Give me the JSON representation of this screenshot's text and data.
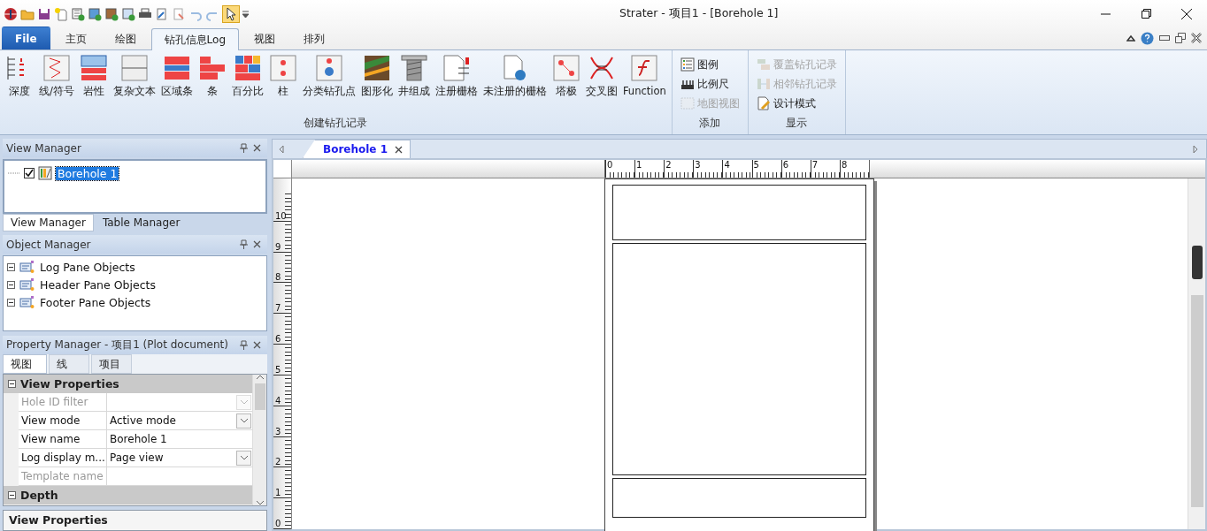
{
  "window": {
    "title": "Strater - 项目1 - [Borehole 1]"
  },
  "ribbon_tabs": [
    {
      "label": "File",
      "kind": "file",
      "selected": false
    },
    {
      "label": "主页",
      "kind": "tab",
      "selected": false
    },
    {
      "label": "绘图",
      "kind": "tab",
      "selected": false
    },
    {
      "label": "钻孔信息Log",
      "kind": "tab",
      "selected": true
    },
    {
      "label": "视图",
      "kind": "tab",
      "selected": false
    },
    {
      "label": "排列",
      "kind": "tab",
      "selected": false
    }
  ],
  "ribbon_groups": [
    {
      "title": "创建钻孔记录",
      "kind": "large",
      "items": [
        {
          "label": "深度",
          "disabled": false
        },
        {
          "label": "线/符号",
          "disabled": false
        },
        {
          "label": "岩性",
          "disabled": false
        },
        {
          "label": "复杂文本",
          "disabled": false
        },
        {
          "label": "区域条",
          "disabled": false
        },
        {
          "label": "条",
          "disabled": false
        },
        {
          "label": "百分比",
          "disabled": false
        },
        {
          "label": "柱",
          "disabled": false
        },
        {
          "label": "分类钻孔点",
          "disabled": false
        },
        {
          "label": "图形化",
          "disabled": false
        },
        {
          "label": "井组成",
          "disabled": false
        },
        {
          "label": "注册栅格",
          "disabled": false
        },
        {
          "label": "未注册的栅格",
          "disabled": false
        },
        {
          "label": "塔极",
          "disabled": false
        },
        {
          "label": "交叉图",
          "disabled": false
        },
        {
          "label": "Function",
          "disabled": false
        }
      ]
    },
    {
      "title": "添加",
      "kind": "small",
      "items": [
        {
          "label": "图例",
          "disabled": false
        },
        {
          "label": "比例尺",
          "disabled": false
        },
        {
          "label": "地图视图",
          "disabled": true
        }
      ]
    },
    {
      "title": "显示",
      "kind": "small",
      "items": [
        {
          "label": "覆盖钻孔记录",
          "disabled": true
        },
        {
          "label": "相邻钻孔记录",
          "disabled": true
        },
        {
          "label": "设计模式",
          "disabled": false
        }
      ]
    }
  ],
  "view_manager": {
    "title": "View Manager",
    "items": [
      {
        "label": "Borehole 1",
        "checked": true,
        "selected": true
      }
    ],
    "tabs": [
      {
        "label": "View Manager",
        "selected": true
      },
      {
        "label": "Table Manager",
        "selected": false
      }
    ]
  },
  "object_manager": {
    "title": "Object Manager",
    "items": [
      {
        "label": "Log Pane Objects",
        "expanded": true
      },
      {
        "label": "Header Pane Objects",
        "expanded": true
      },
      {
        "label": "Footer Pane Objects",
        "expanded": true
      }
    ]
  },
  "property_manager": {
    "title": "Property Manager - 项目1 (Plot document)",
    "tabs": [
      {
        "label": "视图",
        "selected": true
      },
      {
        "label": "线",
        "selected": false
      },
      {
        "label": "项目",
        "selected": false
      }
    ],
    "categories": [
      {
        "label": "View Properties",
        "expanded": true,
        "rows": [
          {
            "label": "Hole ID filter",
            "value": "",
            "dropdown": true,
            "disabled": true
          },
          {
            "label": "View mode",
            "value": "Active mode",
            "dropdown": true,
            "disabled": false
          },
          {
            "label": "View name",
            "value": "Borehole 1",
            "dropdown": false,
            "disabled": false
          },
          {
            "label": "Log display m...",
            "value": "Page view",
            "dropdown": true,
            "disabled": false
          },
          {
            "label": "Template name",
            "value": "",
            "dropdown": false,
            "disabled": true
          }
        ]
      },
      {
        "label": "Depth",
        "expanded": true
      }
    ],
    "description": "View Properties"
  },
  "document_tabs": [
    {
      "label": "Borehole 1",
      "selected": true
    }
  ],
  "ruler": {
    "horizontal": [
      "0",
      "1",
      "2",
      "3",
      "4",
      "5",
      "6",
      "7",
      "8"
    ],
    "vertical": [
      "10",
      "9",
      "8",
      "7",
      "6",
      "5",
      "4",
      "3",
      "2",
      "1",
      "0"
    ]
  }
}
